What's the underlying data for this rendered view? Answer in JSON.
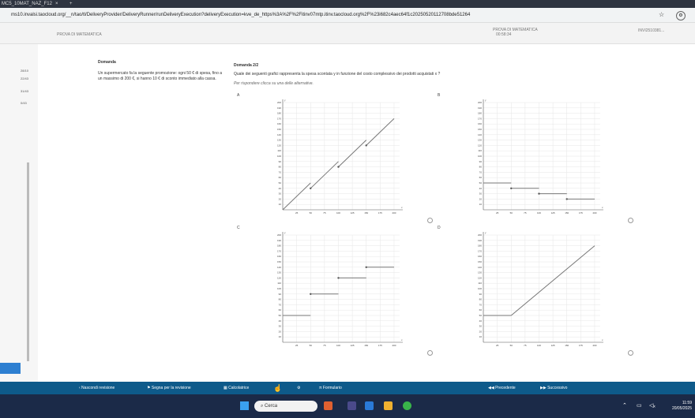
{
  "browser": {
    "tab_title": "MC5_10MAT_NAZ_F12",
    "tab_close": "×",
    "tab_new": "+",
    "url": "ms10.invalsi.taocloud.org/__n/tao/tl/DeliveryProvider/DeliveryRunner/runDeliveryExecution?deliveryExecution=kve_de_https%3A%2F%2Fitinv07mtp.itinv.taocloud.org%2F%23i682c4aec64f1c20250520112708bde51264",
    "star": "☆"
  },
  "header": {
    "exam_title": "PROVA DI MATEMATICA",
    "timer_label": "PROVA DI MATEMATICA",
    "timer": "00:58:34",
    "user": "INVI2510381..."
  },
  "sidebar": {
    "rows": [
      "28/10",
      "22/43",
      "31/43",
      "0/43"
    ]
  },
  "question": {
    "left_label": "Domanda",
    "stem": "Un supermercato fa la seguente promozione: ogni 50 € di spesa, fino a un massimo di 200 €, si hanno 10 € di sconto immediato alla cassa.",
    "number": "Domanda 2/2",
    "prompt": "Quale dei seguenti grafici rappresenta la spesa scontata y in funzione del costo complessivo dei prodotti acquistati x ?",
    "instruction": "Per rispondere clicca su una delle alternative."
  },
  "options": [
    "A",
    "B",
    "C",
    "D"
  ],
  "chart_data": [
    {
      "type": "line",
      "option": "A",
      "xlabel": "x",
      "ylabel": "y",
      "xlim": [
        0,
        210
      ],
      "ylim": [
        0,
        200
      ],
      "series": [
        {
          "segments": [
            [
              [
                0,
                0
              ],
              [
                50,
                50
              ]
            ],
            [
              [
                50,
                40
              ],
              [
                100,
                90
              ]
            ],
            [
              [
                100,
                80
              ],
              [
                150,
                130
              ]
            ],
            [
              [
                150,
                120
              ],
              [
                200,
                170
              ]
            ]
          ]
        }
      ]
    },
    {
      "type": "line",
      "option": "B",
      "xlabel": "x",
      "ylabel": "y",
      "xlim": [
        0,
        210
      ],
      "ylim": [
        0,
        200
      ],
      "series": [
        {
          "segments": [
            [
              [
                0,
                50
              ],
              [
                50,
                50
              ]
            ],
            [
              [
                50,
                40
              ],
              [
                100,
                40
              ]
            ],
            [
              [
                100,
                30
              ],
              [
                150,
                30
              ]
            ],
            [
              [
                150,
                20
              ],
              [
                200,
                20
              ]
            ]
          ]
        }
      ]
    },
    {
      "type": "line",
      "option": "C",
      "xlabel": "x",
      "ylabel": "y",
      "xlim": [
        0,
        210
      ],
      "ylim": [
        0,
        200
      ],
      "series": [
        {
          "segments": [
            [
              [
                0,
                50
              ],
              [
                50,
                50
              ]
            ],
            [
              [
                50,
                90
              ],
              [
                100,
                90
              ]
            ],
            [
              [
                100,
                120
              ],
              [
                150,
                120
              ]
            ],
            [
              [
                150,
                140
              ],
              [
                200,
                140
              ]
            ]
          ]
        }
      ]
    },
    {
      "type": "line",
      "option": "D",
      "xlabel": "x",
      "ylabel": "y",
      "xlim": [
        0,
        210
      ],
      "ylim": [
        0,
        200
      ],
      "series": [
        {
          "segments": [
            [
              [
                0,
                50
              ],
              [
                50,
                50
              ]
            ],
            [
              [
                50,
                50
              ],
              [
                200,
                180
              ]
            ]
          ]
        }
      ]
    }
  ],
  "axis_ticks": {
    "x": [
      25,
      50,
      75,
      100,
      125,
      150,
      175,
      200
    ],
    "y": [
      10,
      20,
      30,
      40,
      50,
      60,
      70,
      80,
      90,
      100,
      110,
      120,
      130,
      140,
      150,
      160,
      170,
      180,
      190,
      200
    ]
  },
  "footer": {
    "hide_review": "‹ Nascondi revisione",
    "flag": "Segna per la revisione",
    "calculator": "Calcolatrice",
    "formulary": "π  Formulario",
    "previous": "◀◀  Precedente",
    "next": "▶▶  Successivo"
  },
  "taskbar": {
    "search": "Cerca",
    "time": "11:59",
    "date": "20/05/2025"
  }
}
